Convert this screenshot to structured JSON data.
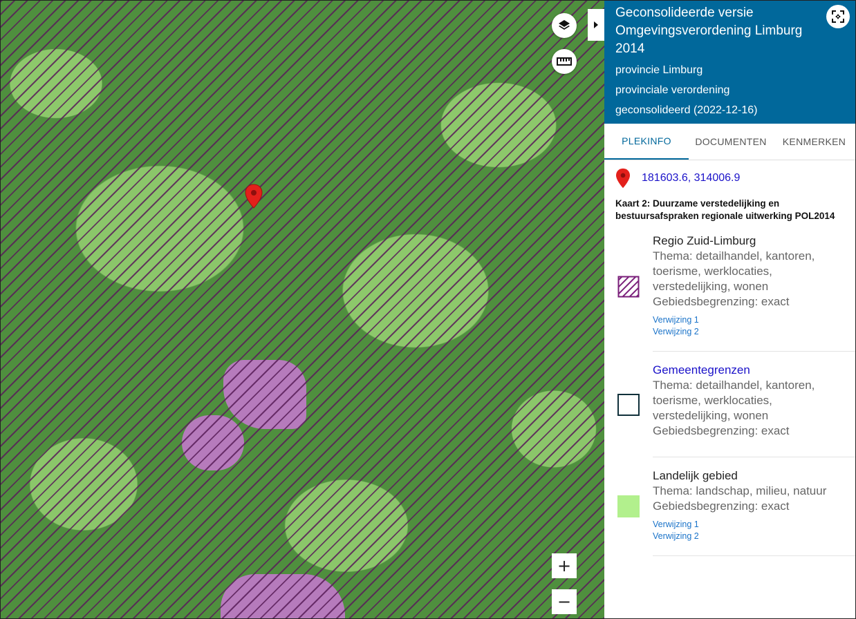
{
  "header": {
    "title": "Geconsolideerde versie Omgevingsverordening Limburg 2014",
    "authority": "provincie Limburg",
    "doc_type": "provinciale verordening",
    "status": "geconsolideerd (2022-12-16)"
  },
  "tabs": [
    {
      "label": "PLEKINFO",
      "active": true
    },
    {
      "label": "DOCUMENTEN",
      "active": false
    },
    {
      "label": "KENMERKEN",
      "active": false
    }
  ],
  "location": {
    "coordinates": "181603.6, 314006.9"
  },
  "kaart": {
    "title": "Kaart 2: Duurzame verstedelijking en bestuursafspraken regionale uitwerking POL2014"
  },
  "entries": [
    {
      "name": "Regio Zuid-Limburg",
      "thema": "Thema: detailhandel, kantoren, toerisme, werklocaties, verstedelijking, wonen",
      "begrenzing": "Gebiedsbegrenzing: exact",
      "links": [
        "Verwijzing 1",
        "Verwijzing 2"
      ],
      "symbol": "hatch-purple"
    },
    {
      "name": "Gemeentegrenzen",
      "thema": "Thema: detailhandel, kantoren, toerisme, werklocaties, verstedelijking, wonen",
      "begrenzing": "Gebiedsbegrenzing: exact",
      "links": [],
      "symbol": "outline-dark"
    },
    {
      "name": "Landelijk gebied",
      "thema": "Thema: landschap, milieu, natuur",
      "begrenzing": "Gebiedsbegrenzing: exact",
      "links": [
        "Verwijzing 1",
        "Verwijzing 2"
      ],
      "symbol": "fill-lightgreen"
    }
  ],
  "map_controls": {
    "zoom_in": "+",
    "zoom_out": "−"
  },
  "icons": {
    "layers": "layers-icon",
    "measure": "ruler-icon",
    "collapse": "chevron-right-icon",
    "fullscreen": "expand-icon",
    "pin": "map-pin-icon"
  },
  "colors": {
    "header_bg": "#01689b",
    "link_blue": "#1b12c9",
    "hatch_purple": "#7a1f7a",
    "landelijk_green": "#b2f08d",
    "map_green": "#4f8f3e",
    "pin_red": "#e3201b"
  }
}
